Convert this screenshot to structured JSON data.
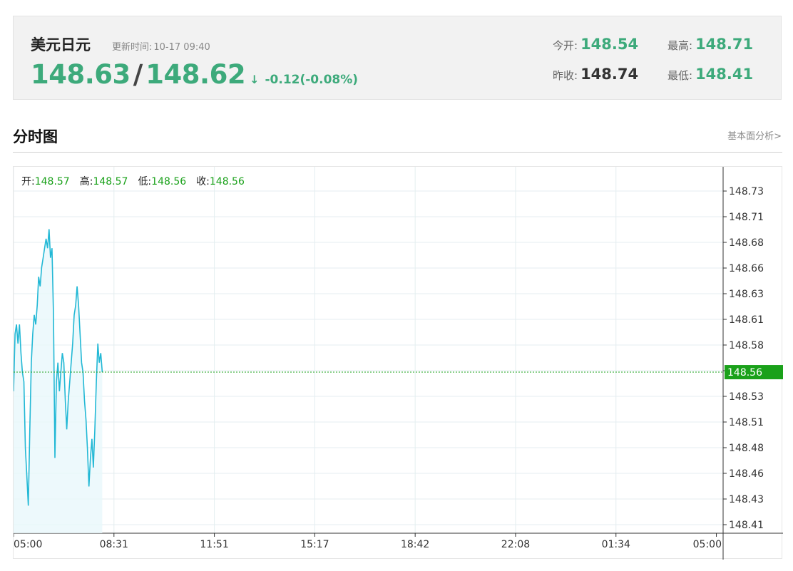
{
  "header": {
    "pair_name": "美元日元",
    "update_label": "更新时间:",
    "update_time": "10-17 09:40",
    "bid": "148.63",
    "separator": "/",
    "ask": "148.62",
    "change_arrow": "↓",
    "change": "-0.12(-0.08%)",
    "stats": {
      "open_label": "今开:",
      "open_value": "148.54",
      "high_label": "最高:",
      "high_value": "148.71",
      "prev_close_label": "昨收:",
      "prev_close_value": "148.74",
      "low_label": "最低:",
      "low_value": "148.41"
    },
    "colors": {
      "price_green": "#3daa7b",
      "line": "#22b8d5",
      "current_tag": "#1aa11a"
    }
  },
  "section": {
    "title": "分时图",
    "link": "基本面分析>"
  },
  "ohlc": {
    "open_label": "开:",
    "open": "148.57",
    "high_label": "高:",
    "high": "148.57",
    "low_label": "低:",
    "low": "148.56",
    "close_label": "收:",
    "close": "148.56"
  },
  "chart_data": {
    "type": "line",
    "title": "",
    "xlabel": "",
    "ylabel": "",
    "ylim": [
      148.4,
      148.75
    ],
    "y_ticks": [
      "148.73",
      "148.71",
      "148.68",
      "148.66",
      "148.63",
      "148.61",
      "148.58",
      "148.56",
      "148.53",
      "148.51",
      "148.48",
      "148.46",
      "148.43",
      "148.41"
    ],
    "y_tick_values": [
      148.73,
      148.7,
      148.68,
      148.65,
      148.63,
      148.6,
      148.58,
      148.55,
      148.53,
      148.5,
      148.48,
      148.45,
      148.43,
      148.4
    ],
    "x_ticks": [
      "05:00",
      "08:31",
      "11:51",
      "15:17",
      "18:42",
      "22:08",
      "01:34",
      "05:00"
    ],
    "x_tick_positions": [
      0.0,
      0.1415,
      0.283,
      0.4245,
      0.566,
      0.7075,
      0.849,
      0.9905
    ],
    "x_range": [
      0,
      1440
    ],
    "current_price": 148.56,
    "current_price_label": "148.56",
    "grid": true,
    "series": [
      {
        "values": [
          [
            0,
            148.54
          ],
          [
            3,
            148.6
          ],
          [
            6,
            148.61
          ],
          [
            9,
            148.59
          ],
          [
            12,
            148.61
          ],
          [
            15,
            148.58
          ],
          [
            18,
            148.56
          ],
          [
            21,
            148.55
          ],
          [
            24,
            148.48
          ],
          [
            27,
            148.45
          ],
          [
            30,
            148.42
          ],
          [
            33,
            148.5
          ],
          [
            36,
            148.57
          ],
          [
            39,
            148.6
          ],
          [
            42,
            148.62
          ],
          [
            45,
            148.61
          ],
          [
            48,
            148.63
          ],
          [
            51,
            148.66
          ],
          [
            54,
            148.65
          ],
          [
            57,
            148.67
          ],
          [
            60,
            148.68
          ],
          [
            63,
            148.69
          ],
          [
            66,
            148.7
          ],
          [
            69,
            148.69
          ],
          [
            72,
            148.71
          ],
          [
            75,
            148.68
          ],
          [
            78,
            148.69
          ],
          [
            81,
            148.62
          ],
          [
            84,
            148.47
          ],
          [
            87,
            148.55
          ],
          [
            90,
            148.57
          ],
          [
            93,
            148.54
          ],
          [
            96,
            148.56
          ],
          [
            99,
            148.58
          ],
          [
            102,
            148.57
          ],
          [
            105,
            148.53
          ],
          [
            108,
            148.5
          ],
          [
            111,
            148.53
          ],
          [
            114,
            148.55
          ],
          [
            117,
            148.57
          ],
          [
            120,
            148.59
          ],
          [
            123,
            148.62
          ],
          [
            126,
            148.63
          ],
          [
            129,
            148.65
          ],
          [
            132,
            148.63
          ],
          [
            135,
            148.6
          ],
          [
            138,
            148.57
          ],
          [
            141,
            148.56
          ],
          [
            144,
            148.53
          ],
          [
            147,
            148.51
          ],
          [
            150,
            148.48
          ],
          [
            153,
            148.44
          ],
          [
            156,
            148.47
          ],
          [
            159,
            148.49
          ],
          [
            162,
            148.46
          ],
          [
            165,
            148.5
          ],
          [
            168,
            148.55
          ],
          [
            171,
            148.59
          ],
          [
            174,
            148.57
          ],
          [
            177,
            148.58
          ],
          [
            180,
            148.56
          ]
        ]
      }
    ]
  }
}
